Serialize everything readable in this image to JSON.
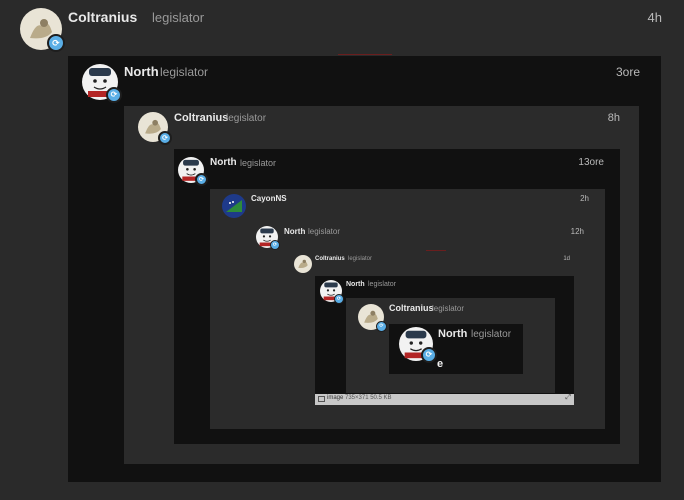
{
  "posts": {
    "p1": {
      "user": "Coltranius",
      "title": "legislator",
      "time": "4h"
    },
    "p2": {
      "user": "North",
      "title": "legislator",
      "time": "3ore"
    },
    "p3": {
      "user": "Coltranius",
      "title": "legislator",
      "time": "8h"
    },
    "p4": {
      "user": "North",
      "title": "legislator",
      "time": "13ore"
    },
    "p5": {
      "user": "CayonNS",
      "title": "",
      "time": "2h"
    },
    "p6": {
      "user": "North",
      "title": "legislator",
      "time": "12h"
    },
    "p7": {
      "user": "Coltranius",
      "title": "legislator",
      "time": "1d"
    },
    "p8": {
      "user": "North",
      "title": "legislator",
      "time": ""
    },
    "p9": {
      "user": "Coltranius",
      "title": "legislator",
      "time": ""
    },
    "p10": {
      "user": "North",
      "title": "legislator",
      "time": ""
    }
  },
  "innermost_text": "e",
  "image_bar": {
    "label": "image",
    "meta": "735×371 50.5 KB"
  },
  "colors": {
    "page_bg": "#2a2a2a",
    "dark_box": "#111111",
    "mid_box": "#2b2b2b",
    "badge": "#5aaee6"
  }
}
